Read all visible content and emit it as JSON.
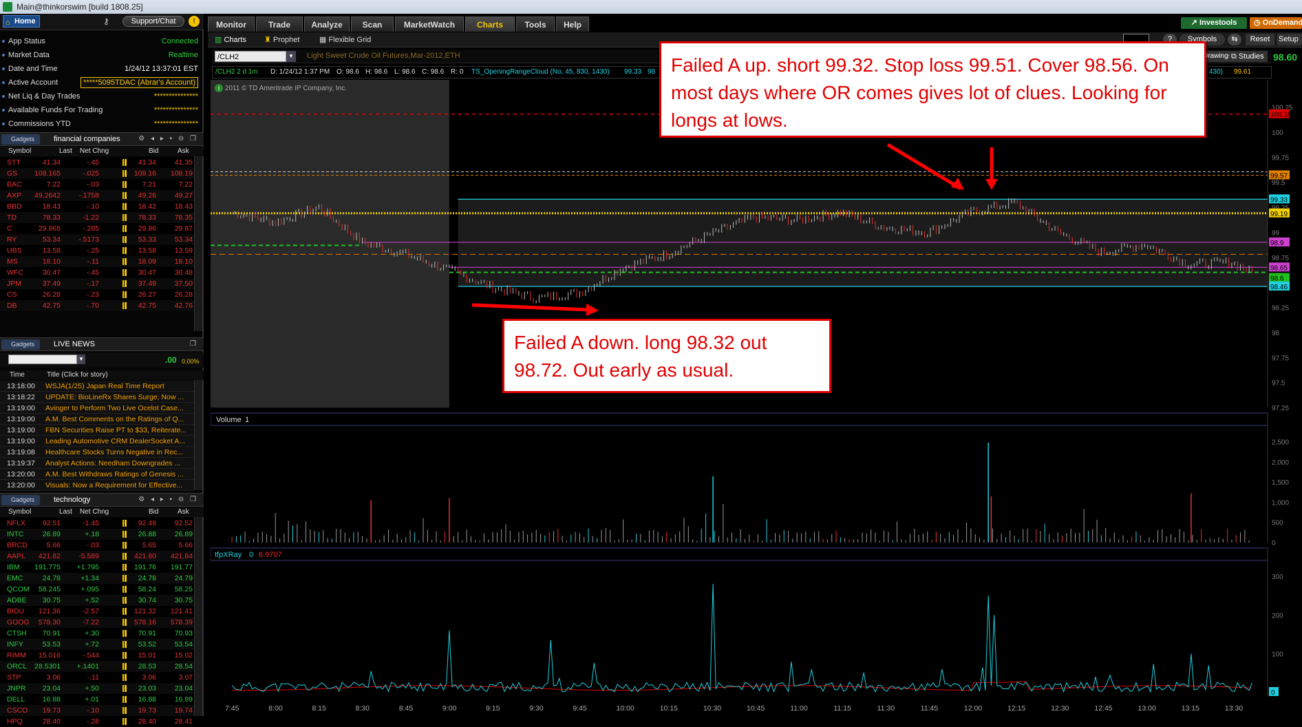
{
  "window": {
    "title": "Main@thinkorswim [build 1808.25]"
  },
  "left": {
    "home": "Home",
    "support": "Support/Chat",
    "account": [
      {
        "label": "App Status",
        "value": "Connected"
      },
      {
        "label": "Market Data",
        "value": "Realtime"
      },
      {
        "label": "Date and Time",
        "value": "1/24/12 13:37:01 EST"
      },
      {
        "label": "Active Account",
        "value": "*****5095TDAC (Abrar's Account)"
      },
      {
        "label": "Net Liq & Day Trades",
        "value": "***************"
      },
      {
        "label": "Available Funds For Trading",
        "value": "***************"
      },
      {
        "label": "Commissions YTD",
        "value": "***************"
      }
    ],
    "gadgets_label": "Gadgets",
    "watch1": {
      "title": "financial companies",
      "headers": [
        "Symbol",
        "Last",
        "Net Chng",
        "Bid",
        "Ask"
      ],
      "rows": [
        [
          "STT",
          "41.34",
          "-.45",
          "41.34",
          "41.35"
        ],
        [
          "GS",
          "108.165",
          "-.025",
          "108.16",
          "108.19"
        ],
        [
          "BAC",
          "7.22",
          "-.03",
          "7.21",
          "7.22"
        ],
        [
          "AXP",
          "49.2642",
          "-.1758",
          "49.26",
          "49.27"
        ],
        [
          "BBD",
          "18.43",
          "-.10",
          "18.42",
          "18.43"
        ],
        [
          "TD",
          "78.33",
          "-1.22",
          "78.33",
          "78.35"
        ],
        [
          "C",
          "29.865",
          "-.285",
          "29.86",
          "29.87"
        ],
        [
          "RY",
          "53.34",
          "-.5173",
          "53.33",
          "53.34"
        ],
        [
          "UBS",
          "13.58",
          "-.25",
          "13.58",
          "13.59"
        ],
        [
          "MS",
          "18.10",
          "-.11",
          "18.09",
          "18.10"
        ],
        [
          "WFC",
          "30.47",
          "-.45",
          "30.47",
          "30.48"
        ],
        [
          "JPM",
          "37.49",
          "-.17",
          "37.49",
          "37.50"
        ],
        [
          "CS",
          "26.28",
          "-.23",
          "26.27",
          "26.28"
        ],
        [
          "DB",
          "42.75",
          "-.70",
          "42.75",
          "42.76"
        ]
      ]
    },
    "news": {
      "title": "LIVE NEWS",
      "value": ".00",
      "pct": "0.00%",
      "headers": [
        "Time",
        "Title (Click for story)"
      ],
      "rows": [
        [
          "13:18:00",
          "WSJA(1/25) Japan Real Time Report"
        ],
        [
          "13:18:22",
          "UPDATE: BioLineRx Shares Surge; Now ..."
        ],
        [
          "13:19:00",
          "Avinger to Perform Two Live Ocelot Case..."
        ],
        [
          "13:19:00",
          "A.M. Best Comments on the Ratings of Q..."
        ],
        [
          "13:19:00",
          "FBN Securities Raise PT to $33, Reiterate..."
        ],
        [
          "13:19:00",
          "Leading Automotive CRM DealerSocket A..."
        ],
        [
          "13:19:08",
          "Healthcare Stocks Turns Negative in Rec..."
        ],
        [
          "13:19:37",
          "Analyst Actions: Needham Downgrades ..."
        ],
        [
          "13:20:00",
          "A.M. Best Withdraws Ratings of Genesis ..."
        ],
        [
          "13:20:00",
          "Visuals: Now a Requirement for Effective..."
        ]
      ]
    },
    "watch2": {
      "title": "technology",
      "headers": [
        "Symbol",
        "Last",
        "Net Chng",
        "Bid",
        "Ask"
      ],
      "rows": [
        [
          "NFLX",
          "92.51",
          "-1.45",
          "92.49",
          "92.52"
        ],
        [
          "INTC",
          "26.89",
          "+.18",
          "26.88",
          "26.89"
        ],
        [
          "BRCD",
          "5.66",
          "-.03",
          "5.65",
          "5.66"
        ],
        [
          "AAPL",
          "421.82",
          "-5.589",
          "421.80",
          "421.84"
        ],
        [
          "IBM",
          "191.775",
          "+1.795",
          "191.76",
          "191.77"
        ],
        [
          "EMC",
          "24.78",
          "+1.34",
          "24.78",
          "24.79"
        ],
        [
          "QCOM",
          "58.245",
          "+.095",
          "58.24",
          "58.25"
        ],
        [
          "ADBE",
          "30.75",
          "+.52",
          "30.74",
          "30.75"
        ],
        [
          "BIDU",
          "121.36",
          "-2.57",
          "121.32",
          "121.41"
        ],
        [
          "GOOG",
          "578.30",
          "-7.22",
          "578.16",
          "578.39"
        ],
        [
          "CTSH",
          "70.91",
          "+.30",
          "70.91",
          "70.93"
        ],
        [
          "INFY",
          "53.53",
          "+.72",
          "53.52",
          "53.54"
        ],
        [
          "RIMM",
          "15.016",
          "-.544",
          "15.01",
          "15.02"
        ],
        [
          "ORCL",
          "28.5301",
          "+.1401",
          "28.53",
          "28.54"
        ],
        [
          "STP",
          "3.06",
          "-.11",
          "3.06",
          "3.07"
        ],
        [
          "JNPR",
          "23.04",
          "+.50",
          "23.03",
          "23.04"
        ],
        [
          "DELL",
          "16.88",
          "+.01",
          "16.88",
          "16.89"
        ],
        [
          "CSCO",
          "19.73",
          "-.10",
          "19.73",
          "19.74"
        ],
        [
          "HPQ",
          "28.40",
          "-.28",
          "28.40",
          "28.41"
        ]
      ]
    }
  },
  "menu": {
    "tabs": [
      "Monitor",
      "Trade",
      "Analyze",
      "Scan",
      "MarketWatch",
      "Charts",
      "Tools",
      "Help"
    ],
    "active": "Charts"
  },
  "subbar": {
    "charts": "Charts",
    "prophet": "Prophet",
    "flexible_grid": "Flexible Grid",
    "symbols": "Symbols",
    "reset": "Reset",
    "setup": "Setup",
    "investools": "Investools",
    "ondemand": "OnDemand",
    "drawings": "Drawings",
    "studies": "Studies",
    "last_price": "98.60"
  },
  "chart": {
    "symbol": "/CLH2",
    "description": "Light Sweet Crude Oil Futures,Mar-2012,ETH",
    "info": {
      "period": "/CLH2 2 d 1m",
      "d": "D: 1/24/12 1:37 PM",
      "o": "O: 98.6",
      "h": "H: 98.6",
      "l": "L: 98.6",
      "c": "C: 98.6",
      "r": "R: 0",
      "study": "TS_OpeningRangeCloud (No, 45, 830, 1430)",
      "v1": "99.33",
      "v2": "98",
      "v3": "430)",
      "v4": "99.61"
    },
    "copyright": "2011 © TD Ameritrade IP Company, Inc.",
    "price_ticks": [
      "100.25",
      "100",
      "99.75",
      "99.5",
      "99.25",
      "99",
      "98.75",
      "98.5",
      "98.25",
      "98",
      "97.75",
      "97.5",
      "97.25"
    ],
    "price_labels": [
      {
        "text": "100.18",
        "color": "#e00000"
      },
      {
        "text": "99.57",
        "color": "#e08000"
      },
      {
        "text": "99.33",
        "color": "#20d0e0"
      },
      {
        "text": "99.19",
        "color": "#f0d000"
      },
      {
        "text": "98.9",
        "color": "#d040d0"
      },
      {
        "text": "98.65",
        "color": "#d040d0"
      },
      {
        "text": "98.6",
        "color": "#20c020"
      },
      {
        "text": "98.46",
        "color": "#20d0e0"
      }
    ],
    "volume_label": "Volume",
    "volume_value": "1",
    "volume_ticks": [
      "2,500",
      "2,000",
      "1,500",
      "1,000",
      "500",
      "0"
    ],
    "xray_label": "tfpXRay",
    "xray_v1": "0",
    "xray_v2": "6.9707",
    "xray_ticks": [
      "300",
      "200",
      "100",
      "0"
    ],
    "time_ticks": [
      "7:45",
      "8:00",
      "8:15",
      "8:30",
      "8:45",
      "9:00",
      "9:15",
      "9:30",
      "9:45",
      "10:00",
      "10:15",
      "10:30",
      "10:45",
      "11:00",
      "11:15",
      "11:30",
      "11:45",
      "12:00",
      "12:15",
      "12:30",
      "12:45",
      "13:00",
      "13:15",
      "13:30"
    ]
  },
  "annotations": {
    "top": "Failed A up. short 99.32. Stop loss 99.51. Cover 98.56. On most days where OR comes gives lot of clues. Looking for longs at lows.",
    "bottom": "Failed A down. long 98.32 out 98.72. Out early as usual."
  },
  "chart_data": {
    "type": "line",
    "title": "",
    "xlabel": "",
    "ylabel": "",
    "ylim": [
      97.25,
      100.35
    ],
    "x": [
      "7:45",
      "8:00",
      "8:15",
      "8:30",
      "8:45",
      "9:00",
      "9:15",
      "9:30",
      "9:45",
      "10:00",
      "10:15",
      "10:30",
      "10:45",
      "11:00",
      "11:15",
      "11:30",
      "11:45",
      "12:00",
      "12:15",
      "12:30",
      "12:45",
      "13:00",
      "13:15",
      "13:30",
      "13:37"
    ],
    "series": [
      {
        "name": "",
        "values": [
          99.2,
          99.1,
          99.25,
          98.9,
          98.78,
          98.62,
          98.45,
          98.34,
          98.4,
          98.65,
          98.78,
          98.98,
          99.15,
          99.12,
          99.2,
          99.05,
          99.0,
          99.2,
          99.3,
          99.0,
          98.8,
          98.88,
          98.68,
          98.7,
          98.6
        ]
      }
    ],
    "levels": {
      "or_high": 99.33,
      "or_low": 98.46,
      "yellow": 99.19,
      "magenta_high": 98.9,
      "magenta_low": 98.65,
      "red_dash": 100.18,
      "orange_dash": 99.57,
      "green_dash": 98.6
    }
  },
  "colors": {
    "accent": "#f5c400",
    "up": "#2ecc40",
    "down": "#e83030",
    "annotation": "#e00000"
  }
}
